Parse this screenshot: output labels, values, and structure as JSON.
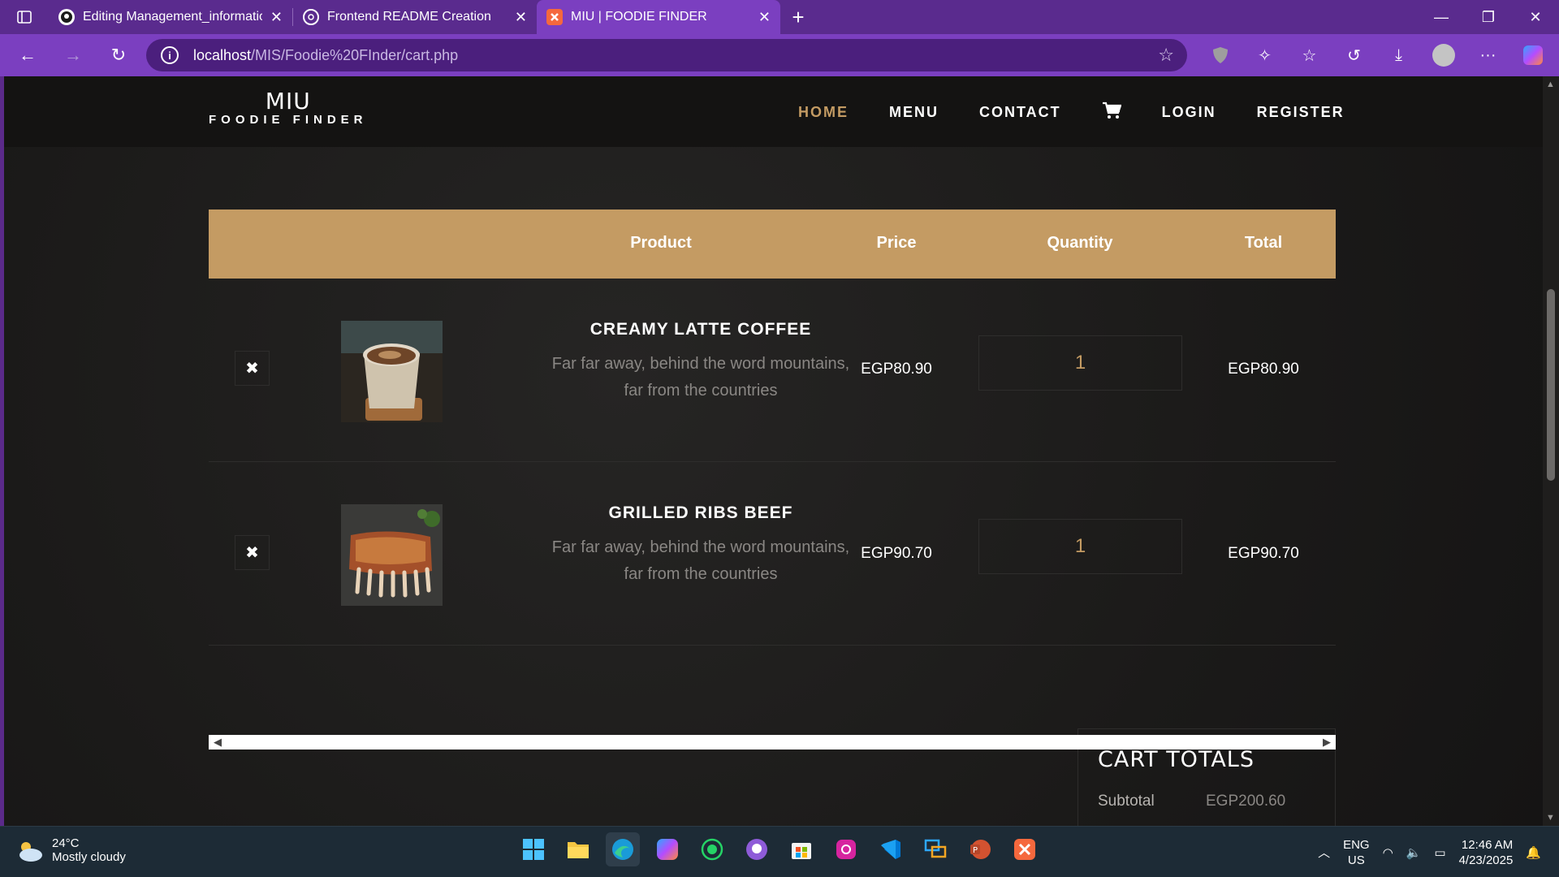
{
  "browser": {
    "tabs": [
      {
        "title": "Editing Management_information",
        "active": false
      },
      {
        "title": "Frontend README Creation",
        "active": false
      },
      {
        "title": "MIU | FOODIE FINDER",
        "active": true
      }
    ],
    "url_host": "localhost",
    "url_path": "/MIS/Foodie%20FInder/cart.php"
  },
  "site": {
    "logo_main": "MIU",
    "logo_sub": "FOODIE FINDER",
    "nav": {
      "home": "HOME",
      "menu": "MENU",
      "contact": "CONTACT",
      "login": "LOGIN",
      "register": "REGISTER"
    }
  },
  "cart": {
    "headers": {
      "product": "Product",
      "price": "Price",
      "quantity": "Quantity",
      "total": "Total"
    },
    "items": [
      {
        "name": "CREAMY LATTE COFFEE",
        "desc1": "Far far away, behind the word mountains,",
        "desc2": "far from the countries",
        "price": "EGP80.90",
        "quantity": "1",
        "total": "EGP80.90"
      },
      {
        "name": "GRILLED RIBS BEEF",
        "desc1": "Far far away, behind the word mountains,",
        "desc2": "far from the countries",
        "price": "EGP90.70",
        "quantity": "1",
        "total": "EGP90.70"
      }
    ],
    "totals": {
      "title": "CART TOTALS",
      "subtotal_label": "Subtotal",
      "subtotal_value": "EGP200.60"
    }
  },
  "taskbar": {
    "temp": "24°C",
    "weather": "Mostly cloudy",
    "lang1": "ENG",
    "lang2": "US",
    "time": "12:46 AM",
    "date": "4/23/2025"
  },
  "colors": {
    "accent": "#c49b63",
    "browser": "#7b3fc0"
  }
}
